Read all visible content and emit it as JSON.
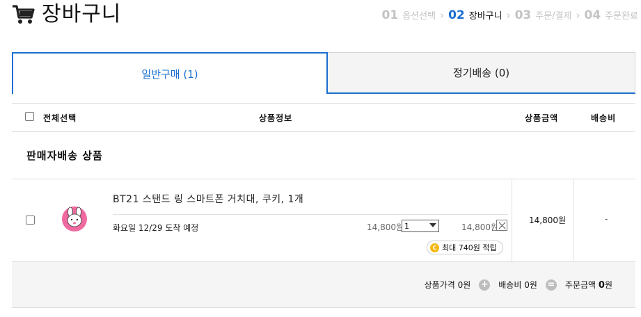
{
  "header": {
    "title": "장바구니",
    "icon": "shopping-cart-icon"
  },
  "steps": [
    {
      "num": "01",
      "label": "옵션선택",
      "active": false
    },
    {
      "num": "02",
      "label": "장바구니",
      "active": true
    },
    {
      "num": "03",
      "label": "주문/결제",
      "active": false
    },
    {
      "num": "04",
      "label": "주문완료",
      "active": false
    }
  ],
  "tabs": {
    "general": "일반구매 (1)",
    "subscription": "정기배송 (0)"
  },
  "table_header": {
    "select_all": "전체선택",
    "product_info": "상품정보",
    "product_price": "상품금액",
    "shipping_fee": "배송비"
  },
  "group": {
    "title": "판매자배송 상품"
  },
  "item": {
    "name": "BT21 스탠드 링 스마트폰 거치대, 쿠키, 1개",
    "delivery": "화요일 12/29 도착 예정",
    "unit_price": "14,800원",
    "quantity": "1",
    "line_price": "14,800원",
    "points": "최대 740원 적립",
    "price": "14,800원",
    "shipping": "-"
  },
  "summary": {
    "product_price_label": "상품가격",
    "product_price_value": "0원",
    "shipping_label": "배송비",
    "shipping_value": "0원",
    "order_label": "주문금액",
    "order_value": "0",
    "order_unit": "원"
  },
  "colors": {
    "accent": "#1a6fd1",
    "coin": "#f5b80e"
  }
}
